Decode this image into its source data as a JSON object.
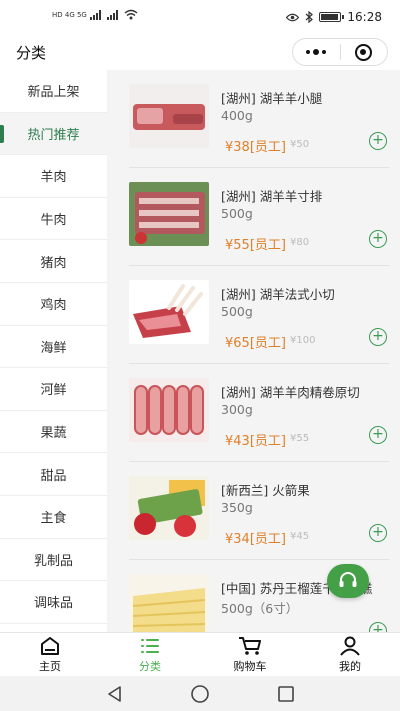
{
  "status": {
    "left": "HD 4G 5G",
    "time": "16:28"
  },
  "nav": {
    "title": "分类"
  },
  "sidebar": {
    "items": [
      {
        "label": "新品上架"
      },
      {
        "label": "热门推荐",
        "active": true
      },
      {
        "label": "羊肉"
      },
      {
        "label": "牛肉"
      },
      {
        "label": "猪肉"
      },
      {
        "label": "鸡肉"
      },
      {
        "label": "海鲜"
      },
      {
        "label": "河鲜"
      },
      {
        "label": "果蔬"
      },
      {
        "label": "甜品"
      },
      {
        "label": "主食"
      },
      {
        "label": "乳制品"
      },
      {
        "label": "调味品"
      }
    ]
  },
  "products": [
    {
      "name": "[湖州] 湖羊羊小腿",
      "spec": "400g",
      "price": "¥38[员工]",
      "old_price": "¥50"
    },
    {
      "name": "[湖州] 湖羊羊寸排",
      "spec": "500g",
      "price": "¥55[员工]",
      "old_price": "¥80"
    },
    {
      "name": "[湖州] 湖羊法式小切",
      "spec": "500g",
      "price": "¥65[员工]",
      "old_price": "¥100"
    },
    {
      "name": "[湖州] 湖羊羊肉精卷原切",
      "spec": "300g",
      "price": "¥43[员工]",
      "old_price": "¥55"
    },
    {
      "name": "[新西兰] 火箭果",
      "spec": "350g",
      "price": "¥34[员工]",
      "old_price": "¥45"
    },
    {
      "name": "[中国] 苏丹王榴莲千层蛋糕",
      "spec": "500g（6寸）",
      "price": "",
      "old_price": ""
    }
  ],
  "product_add_symbol": "+",
  "tabbar": {
    "items": [
      {
        "label": "主页",
        "icon": "home-icon"
      },
      {
        "label": "分类",
        "icon": "list-icon",
        "active": true
      },
      {
        "label": "购物车",
        "icon": "cart-icon"
      },
      {
        "label": "我的",
        "icon": "user-icon"
      }
    ]
  },
  "colors": {
    "accent": "#4caf50",
    "sidebar_active": "#2e7d4f",
    "price": "#e0802a"
  }
}
